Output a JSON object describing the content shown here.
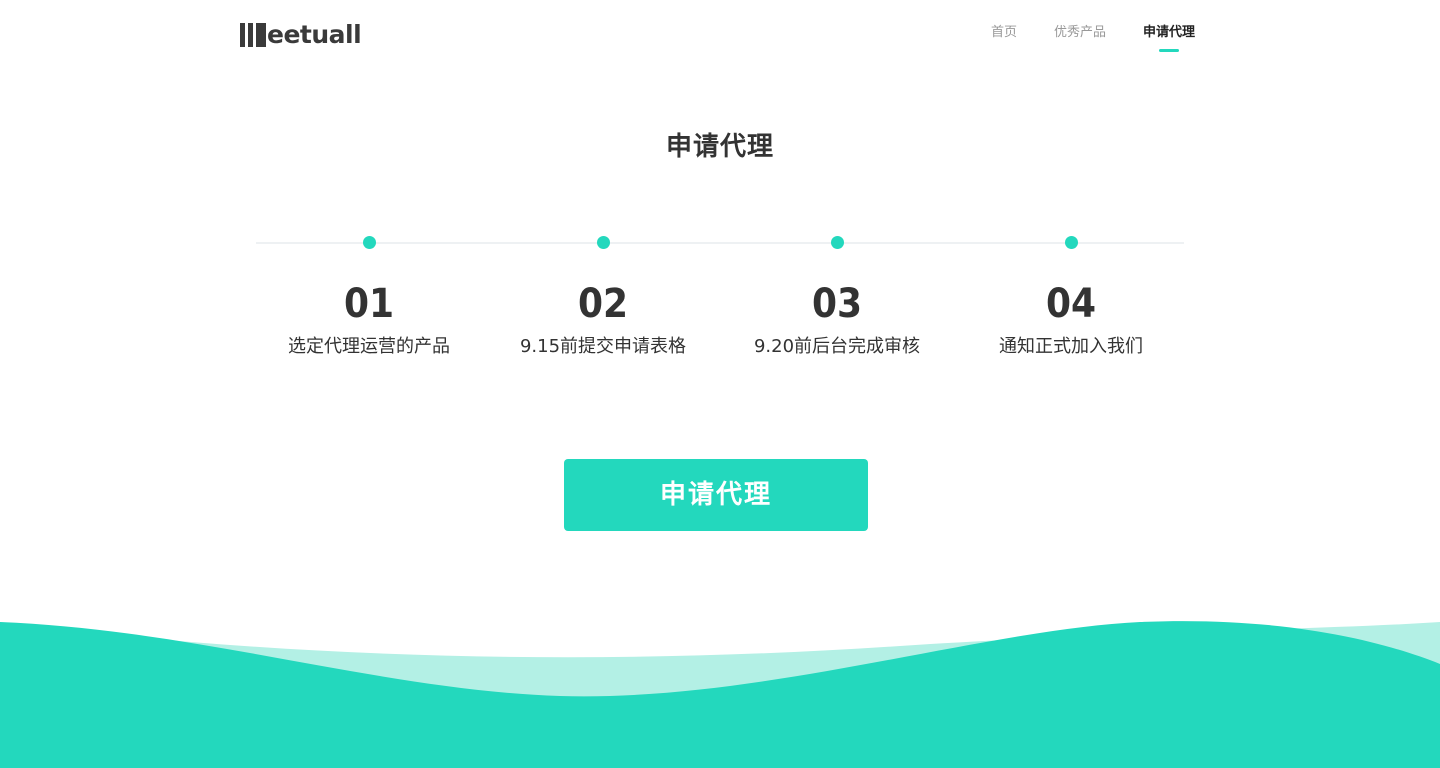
{
  "header": {
    "logo_text": "eetuall",
    "nav": [
      {
        "label": "首页",
        "active": false
      },
      {
        "label": "优秀产品",
        "active": false
      },
      {
        "label": "申请代理",
        "active": true
      }
    ]
  },
  "main": {
    "title": "申请代理",
    "steps": [
      {
        "number": "01",
        "text": "选定代理运营的产品"
      },
      {
        "number": "02",
        "text": "9.15前提交申请表格"
      },
      {
        "number": "03",
        "text": "9.20前后台完成审核"
      },
      {
        "number": "04",
        "text": "通知正式加入我们"
      }
    ],
    "button_label": "申请代理"
  },
  "colors": {
    "accent": "#23d8bd",
    "accent_light": "#b3f0e5",
    "text": "#333333",
    "muted": "#999999"
  }
}
